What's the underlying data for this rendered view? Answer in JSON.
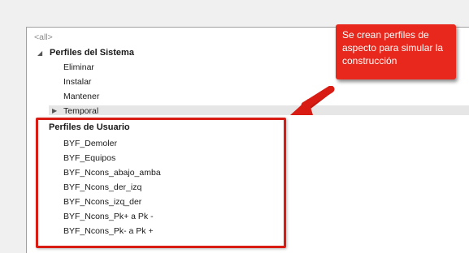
{
  "tree": {
    "all_label": "<all>",
    "system_group": {
      "label": "Perfiles del Sistema",
      "items": [
        "Eliminar",
        "Instalar",
        "Mantener"
      ],
      "collapsed_child": "Temporal"
    },
    "user_group": {
      "label": "Perfiles de Usuario",
      "items": [
        "BYF_Demoler",
        "BYF_Equipos",
        "BYF_Ncons_abajo_amba",
        "BYF_Ncons_der_izq",
        "BYF_Ncons_izq_der",
        "BYF_Ncons_Pk+ a Pk -",
        "BYF_Ncons_Pk- a Pk +"
      ]
    }
  },
  "annotation": {
    "callout_text": "Se crean perfiles de aspecto para simular la construcción",
    "callout_color": "#e8281c",
    "highlight_color": "#d81b13"
  }
}
